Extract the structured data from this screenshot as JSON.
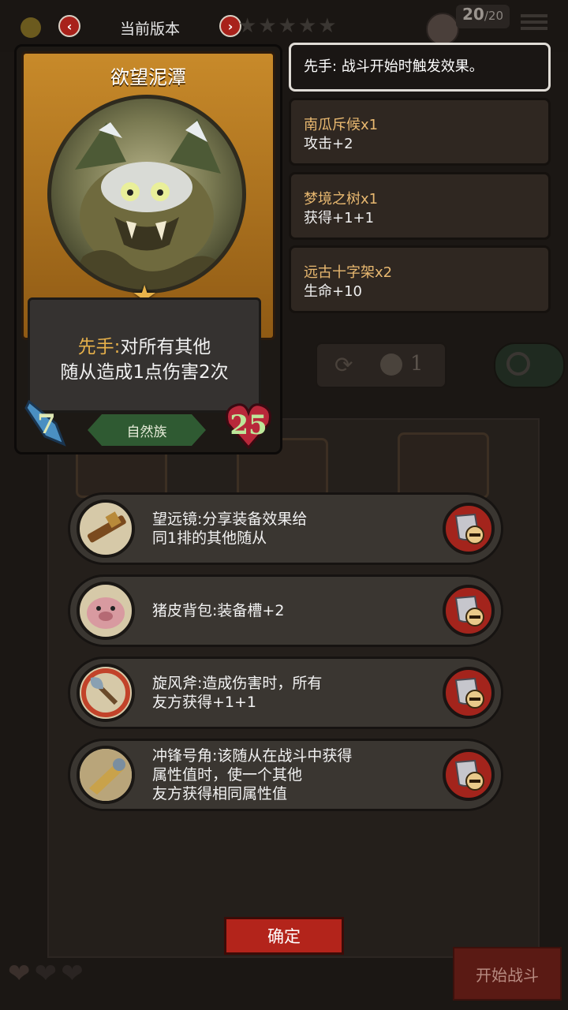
{
  "topbar": {
    "version_label": "当前版本",
    "prev_icon": "chevron-left-icon",
    "next_icon": "chevron-right-icon",
    "stars_total": 5,
    "stars_filled": 0,
    "turn_current": "20",
    "turn_max": "/20"
  },
  "card": {
    "name": "欲望泥潭",
    "ability_keyword": "先手:",
    "ability_text_1": "对所有其他",
    "ability_text_2": "随从造成1点伤害2次",
    "tribe": "自然族",
    "attack": "7",
    "health": "25"
  },
  "info_panels": [
    {
      "name": "先手:",
      "text": "战斗开始时触发效果。"
    },
    {
      "name": "南瓜斥候x1",
      "text": "攻击+2"
    },
    {
      "name": "梦境之树x1",
      "text": "获得+1+1"
    },
    {
      "name": "远古十字架x2",
      "text": "生命+10"
    }
  ],
  "shop": {
    "refresh_cost": "1"
  },
  "equipment": [
    {
      "text": "望远镜:分享装备效果给\n同1排的其他随从",
      "icon": "spyglass-icon"
    },
    {
      "text": "猪皮背包:装备槽+2",
      "icon": "pig-backpack-icon"
    },
    {
      "text": "旋风斧:造成伤害时，所有\n友方获得+1+1",
      "icon": "whirlwind-axe-icon"
    },
    {
      "text": "冲锋号角:该随从在战斗中获得\n属性值时，使一个其他\n友方获得相同属性值",
      "icon": "war-horn-icon"
    }
  ],
  "buttons": {
    "confirm": "确定",
    "start_battle": "开始战斗"
  },
  "colors": {
    "accent_red": "#b3241b",
    "keyword_gold": "#e6b04a",
    "tribe_green": "#2f5a32"
  }
}
